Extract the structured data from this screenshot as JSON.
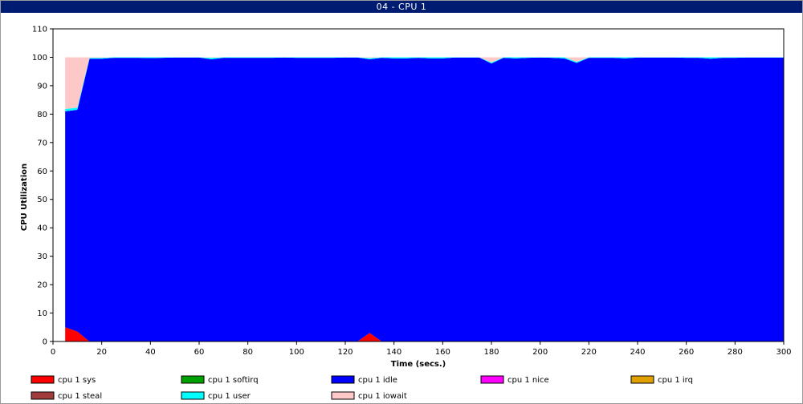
{
  "window": {
    "title": "04 - CPU 1"
  },
  "chart_data": {
    "type": "area",
    "stacked": true,
    "xlabel": "Time (secs.)",
    "ylabel": "CPU Utilization",
    "xlim": [
      0,
      300
    ],
    "ylim": [
      0,
      110
    ],
    "xticks": [
      0,
      20,
      40,
      60,
      80,
      100,
      120,
      140,
      160,
      180,
      200,
      220,
      240,
      260,
      280,
      300
    ],
    "yticks": [
      0,
      10,
      20,
      30,
      40,
      50,
      60,
      70,
      80,
      90,
      100,
      110
    ],
    "grid": false,
    "legend_position": "bottom",
    "x": [
      5,
      10,
      15,
      20,
      25,
      30,
      35,
      40,
      45,
      50,
      55,
      60,
      65,
      70,
      75,
      80,
      85,
      90,
      95,
      100,
      105,
      110,
      115,
      120,
      125,
      130,
      135,
      140,
      145,
      150,
      155,
      160,
      165,
      170,
      175,
      180,
      185,
      190,
      195,
      200,
      205,
      210,
      215,
      220,
      225,
      230,
      235,
      240,
      245,
      250,
      255,
      260,
      265,
      270,
      275,
      280,
      285,
      290,
      295,
      300
    ],
    "series": [
      {
        "name": "cpu 1 sys",
        "color": "#ff0000",
        "values": [
          5,
          3.5,
          0,
          0,
          0,
          0,
          0,
          0,
          0,
          0,
          0,
          0,
          0,
          0,
          0,
          0,
          0,
          0,
          0,
          0,
          0,
          0,
          0,
          0,
          0,
          3,
          0,
          0,
          0,
          0,
          0,
          0,
          0,
          0,
          0,
          0,
          0,
          0,
          0,
          0,
          0,
          0,
          0,
          0,
          0,
          0,
          0,
          0,
          0,
          0,
          0,
          0,
          0,
          0,
          0,
          0,
          0,
          0,
          0,
          0
        ]
      },
      {
        "name": "cpu 1 softirq",
        "color": "#00a000",
        "values": [
          0,
          0,
          0,
          0,
          0,
          0,
          0,
          0,
          0,
          0,
          0,
          0,
          0,
          0,
          0,
          0,
          0,
          0,
          0,
          0,
          0,
          0,
          0,
          0,
          0,
          0,
          0,
          0,
          0,
          0,
          0,
          0,
          0,
          0,
          0,
          0,
          0,
          0,
          0,
          0,
          0,
          0,
          0,
          0,
          0,
          0,
          0,
          0,
          0,
          0,
          0,
          0,
          0,
          0,
          0,
          0,
          0,
          0,
          0,
          0
        ]
      },
      {
        "name": "cpu 1 idle",
        "color": "#0000ff",
        "values": [
          76,
          78,
          99.5,
          99.5,
          99.8,
          99.8,
          99.8,
          99.7,
          99.8,
          99.9,
          99.9,
          99.9,
          99.3,
          99.8,
          99.8,
          99.8,
          99.8,
          99.8,
          99.9,
          99.8,
          99.8,
          99.8,
          99.8,
          99.9,
          99.9,
          96.3,
          99.8,
          99.6,
          99.6,
          99.8,
          99.6,
          99.6,
          99.9,
          99.9,
          99.9,
          97.8,
          99.8,
          99.6,
          99.8,
          99.9,
          99.8,
          99.6,
          98,
          99.8,
          99.8,
          99.8,
          99.6,
          99.9,
          99.9,
          99.9,
          99.9,
          99.8,
          99.8,
          99.5,
          99.8,
          99.8,
          99.9,
          99.9,
          99.9,
          99.9
        ]
      },
      {
        "name": "cpu 1 nice",
        "color": "#ff00ff",
        "values": [
          0,
          0,
          0,
          0,
          0,
          0,
          0,
          0,
          0,
          0,
          0,
          0,
          0,
          0,
          0,
          0,
          0,
          0,
          0,
          0,
          0,
          0,
          0,
          0,
          0,
          0,
          0,
          0,
          0,
          0,
          0,
          0,
          0,
          0,
          0,
          0,
          0,
          0,
          0,
          0,
          0,
          0,
          0,
          0,
          0,
          0,
          0,
          0,
          0,
          0,
          0,
          0,
          0,
          0,
          0,
          0,
          0,
          0,
          0,
          0
        ]
      },
      {
        "name": "cpu 1 irq",
        "color": "#e0a000",
        "values": [
          0,
          0,
          0,
          0,
          0,
          0,
          0,
          0,
          0,
          0,
          0,
          0,
          0,
          0,
          0,
          0,
          0,
          0,
          0,
          0,
          0,
          0,
          0,
          0,
          0,
          0,
          0,
          0,
          0,
          0,
          0,
          0,
          0,
          0,
          0,
          0,
          0,
          0,
          0,
          0,
          0,
          0,
          0,
          0,
          0,
          0,
          0,
          0,
          0,
          0,
          0,
          0,
          0,
          0,
          0,
          0,
          0,
          0,
          0,
          0
        ]
      },
      {
        "name": "cpu 1 steal",
        "color": "#a03c3c",
        "values": [
          0,
          0,
          0,
          0,
          0,
          0,
          0,
          0,
          0,
          0,
          0,
          0,
          0,
          0,
          0,
          0,
          0,
          0,
          0,
          0,
          0,
          0,
          0,
          0,
          0,
          0,
          0,
          0,
          0,
          0,
          0,
          0,
          0,
          0,
          0,
          0,
          0,
          0,
          0,
          0,
          0,
          0,
          0,
          0,
          0,
          0,
          0,
          0,
          0,
          0,
          0,
          0,
          0,
          0,
          0,
          0,
          0,
          0,
          0,
          0
        ]
      },
      {
        "name": "cpu 1 user",
        "color": "#00ffff",
        "values": [
          0.8,
          0.8,
          0.3,
          0.3,
          0.2,
          0.2,
          0.2,
          0.3,
          0.2,
          0.1,
          0.1,
          0.1,
          0.5,
          0.2,
          0.2,
          0.2,
          0.2,
          0.2,
          0.1,
          0.2,
          0.2,
          0.2,
          0.2,
          0.1,
          0.1,
          0.4,
          0.2,
          0.4,
          0.4,
          0.2,
          0.4,
          0.4,
          0.1,
          0.1,
          0.1,
          0.4,
          0.2,
          0.4,
          0.2,
          0.1,
          0.2,
          0.4,
          0.4,
          0.2,
          0.2,
          0.2,
          0.4,
          0.1,
          0.1,
          0.1,
          0.1,
          0.2,
          0.2,
          0.5,
          0.2,
          0.2,
          0.1,
          0.1,
          0.1,
          0.1
        ]
      },
      {
        "name": "cpu 1 iowait",
        "color": "#ffc8c8",
        "values": [
          18.2,
          17.7,
          0.2,
          0.2,
          0,
          0,
          0,
          0,
          0,
          0,
          0,
          0,
          0.2,
          0,
          0,
          0,
          0,
          0,
          0,
          0,
          0,
          0,
          0,
          0,
          0,
          0.3,
          0,
          0,
          0,
          0,
          0,
          0,
          0,
          0,
          0,
          1.8,
          0,
          0,
          0,
          0,
          0,
          0,
          1.6,
          0,
          0,
          0,
          0,
          0,
          0,
          0,
          0,
          0,
          0,
          0,
          0,
          0,
          0,
          0,
          0,
          0
        ]
      }
    ]
  }
}
